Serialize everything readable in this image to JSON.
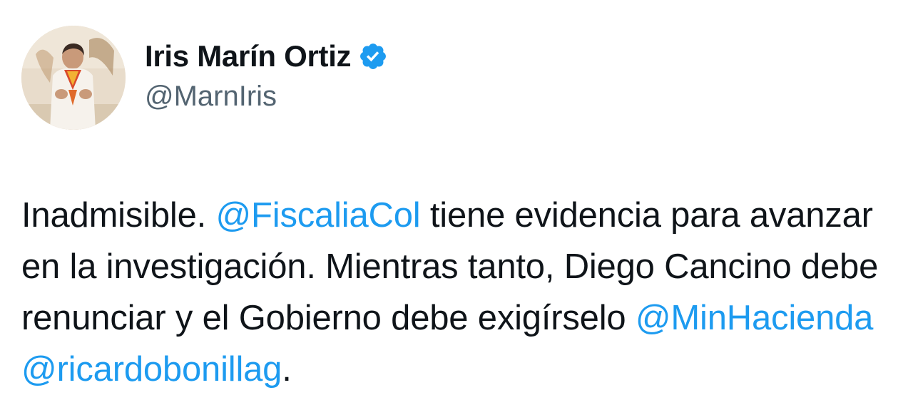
{
  "author": {
    "display_name": "Iris Marín Ortiz",
    "handle": "@MarnIris",
    "verified": true,
    "avatar": "profile-photo"
  },
  "tweet": {
    "segments": [
      {
        "text": "Inadmisible. ",
        "mention": false
      },
      {
        "text": "@FiscaliaCol",
        "mention": true
      },
      {
        "text": " tiene evidencia para avanzar en la investigación. Mientras tanto, Diego Cancino debe renunciar y el Gobierno debe exigírselo ",
        "mention": false
      },
      {
        "text": "@MinHacienda",
        "mention": true
      },
      {
        "text": " ",
        "mention": false
      },
      {
        "text": "@ricardobonillag",
        "mention": true
      },
      {
        "text": ".",
        "mention": false
      }
    ]
  },
  "colors": {
    "text": "#0f1419",
    "handle": "#536471",
    "mention": "#1d9bf0",
    "verified_badge": "#1d9bf0"
  },
  "icons": {
    "verified": "verified-badge-icon"
  }
}
